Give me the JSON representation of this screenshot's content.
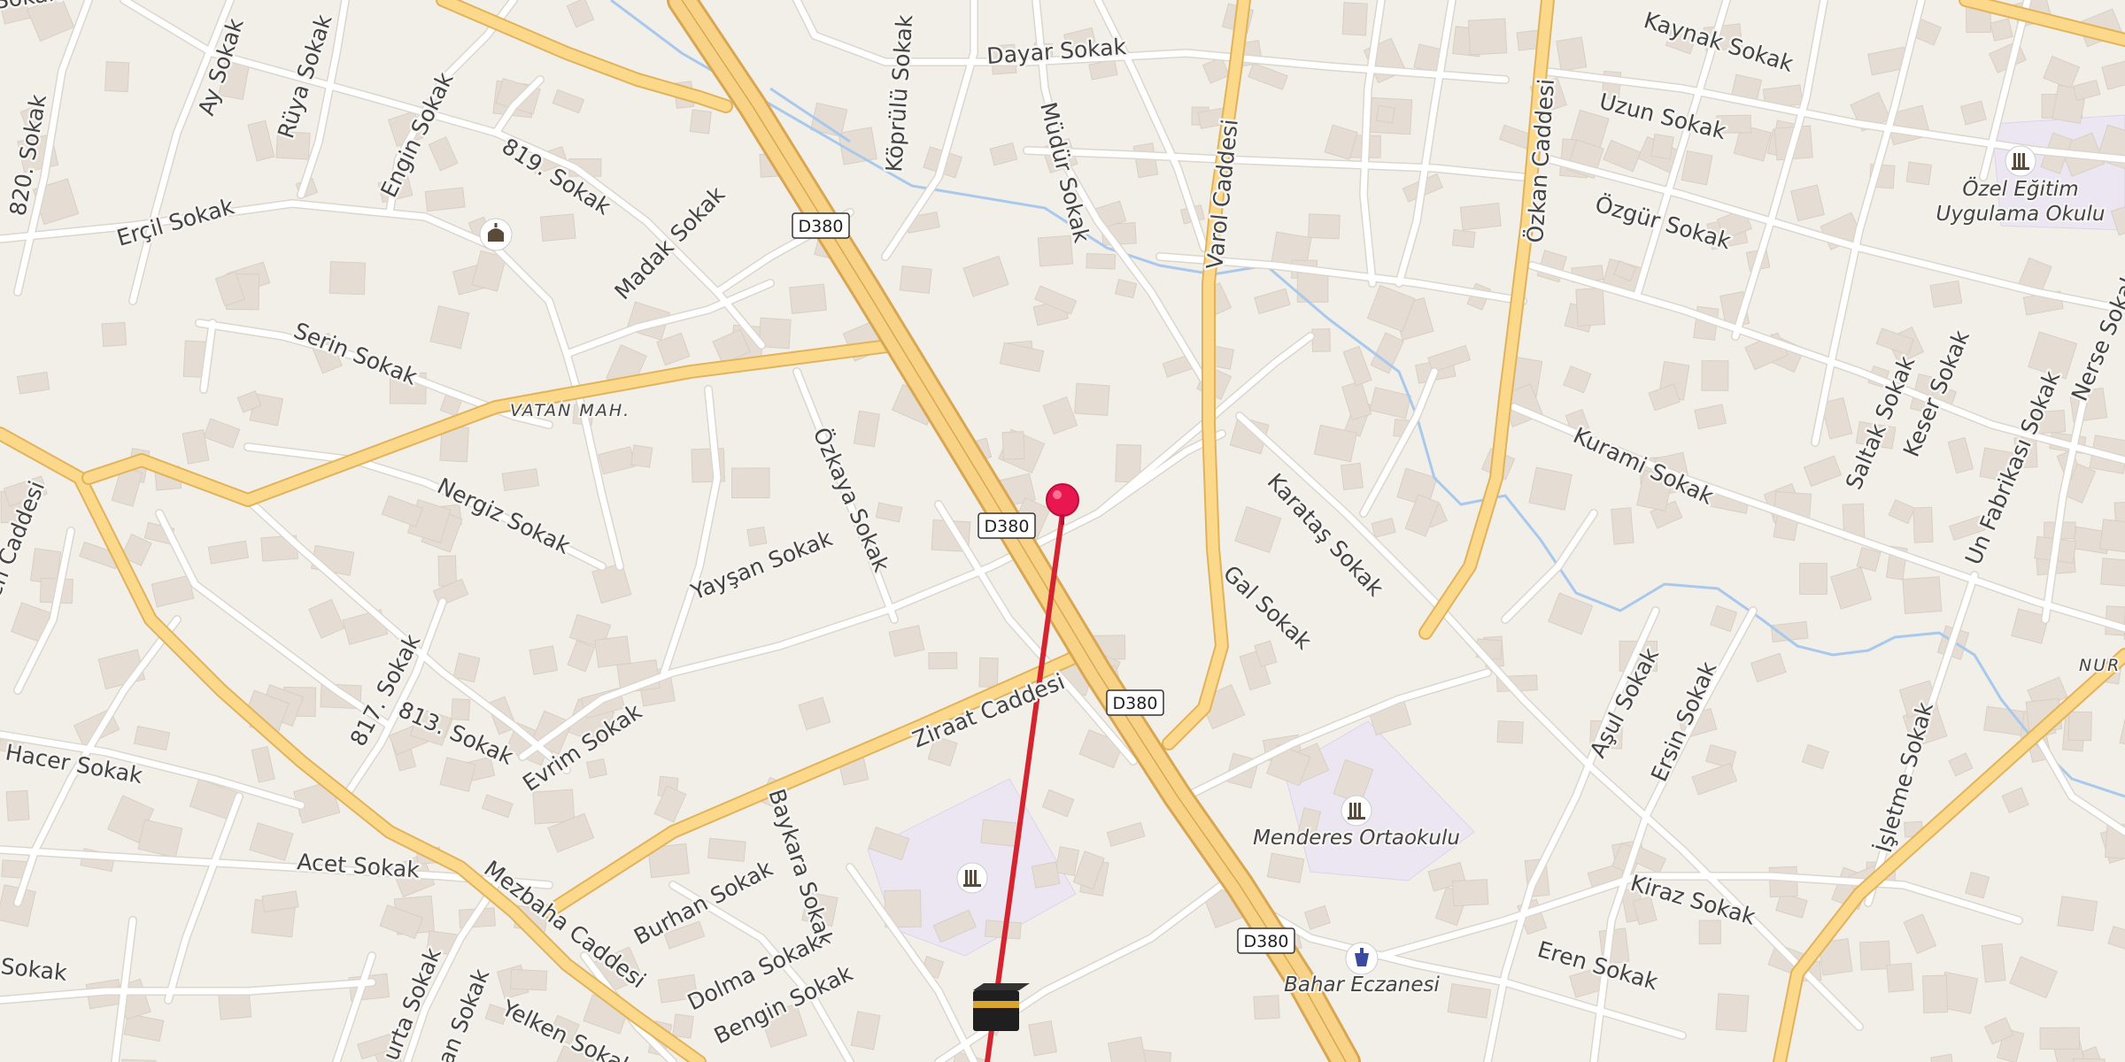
{
  "map": {
    "area_label": "VATAN MAH.",
    "edge_label": "NUR",
    "route_shields": [
      "D380",
      "D380",
      "D380",
      "D380"
    ],
    "streets": {
      "kaynak": "Kaynak Sokak",
      "dayar": "Dayar Sokak",
      "uzun": "Uzun Sokak",
      "ozgur": "Özgür Sokak",
      "koprulu": "Köprülü Sokak",
      "mudur": "Müdür Sokak",
      "varol": "Varol Caddesi",
      "ozkan": "Özkan Caddesi",
      "s820": "820. Sokak",
      "ay": "Ay Sokak",
      "ruya": "Rüya Sokak",
      "engin": "Engin Sokak",
      "s819": "819. Sokak",
      "ercil": "Erçil Sokak",
      "madak": "Madak Sokak",
      "serin": "Serin Sokak",
      "nergiz": "Nergiz Sokak",
      "ozkaya": "Özkaya Sokak",
      "yaysan": "Yayşan Sokak",
      "karatas": "Karataş Sokak",
      "gal": "Gal Sokak",
      "kurami": "Kurami Sokak",
      "saltak": "Saltak Sokak",
      "keser": "Keser Sokak",
      "unfab": "Un Fabrikası Sokak",
      "nerse": "Nerse Sokak",
      "ulen": "ülen Caddesi",
      "s817": "817. Sokak",
      "s813": "813. Sokak",
      "evrim": "Evrim Sokak",
      "ziraat": "Ziraat Caddesi",
      "hacer": "Hacer Sokak",
      "acet": "Acet Sokak",
      "mezbaha": "Mezbaha Caddesi",
      "baykara": "Baykara Sokak",
      "burhan": "Burhan Sokak",
      "dolma": "Dolma Sokak",
      "bengin": "Bengin Sokak",
      "yelken": "Yelken Sokak",
      "sokak_left": "Sokak",
      "urta": "urta Sokak",
      "an": "an Sokak",
      "asul": "Aşul Sokak",
      "ersin": "Ersin Sokak",
      "isletme": "İşletme Sokak",
      "kiraz": "Kiraz Sokak",
      "eren": "Eren Sokak",
      "sokak_top": "Sokak"
    },
    "pois": {
      "school_ne_line1": "Özel Eğitim",
      "school_ne_line2": "Uygulama Okulu",
      "menderes": "Menderes Ortaokulu",
      "pharmacy": "Bahar Eczanesi"
    },
    "icons": {
      "school": "school-icon",
      "mosque": "mosque-icon",
      "pharmacy": "pharmacy-icon",
      "kaaba": "kaaba-icon",
      "pin": "location-pin-icon"
    },
    "colors": {
      "background": "#f2efe9",
      "major_road": "#fbd88a",
      "water": "#a8c8ec",
      "route_line": "#d42430",
      "pin": "#e8174f",
      "school_area": "#ece6f3"
    }
  }
}
